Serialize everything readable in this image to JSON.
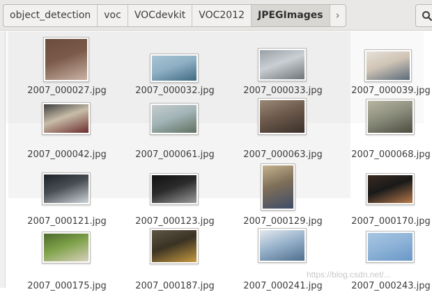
{
  "breadcrumb": [
    "object_detection",
    "voc",
    "VOCdevkit",
    "VOC2012",
    "JPEGImages"
  ],
  "breadcrumb_more_icon": "chevron-right-icon",
  "search_icon": "search-icon",
  "files": [
    {
      "name": "2007_000027.jpg",
      "colors": [
        "#7b5a4a",
        "#c9b3a5",
        "#6a4d3d"
      ]
    },
    {
      "name": "2007_000032.jpg",
      "colors": [
        "#8fb0c4",
        "#3f6a80",
        "#a6c4d3"
      ]
    },
    {
      "name": "2007_000033.jpg",
      "colors": [
        "#c9cfd3",
        "#6f7478",
        "#9aa1a6"
      ]
    },
    {
      "name": "2007_000039.jpg",
      "colors": [
        "#cfc4b5",
        "#5a6a7a",
        "#e6e0d8"
      ]
    },
    {
      "name": "2007_000042.jpg",
      "colors": [
        "#c8bda8",
        "#6b2c2c",
        "#3e3e3e"
      ]
    },
    {
      "name": "2007_000061.jpg",
      "colors": [
        "#a3b5b8",
        "#5f7060",
        "#c5cccc"
      ]
    },
    {
      "name": "2007_000063.jpg",
      "colors": [
        "#6d5a4c",
        "#3a302a",
        "#9a8877"
      ]
    },
    {
      "name": "2007_000068.jpg",
      "colors": [
        "#8d8f7e",
        "#4c4c40",
        "#b8b5a2"
      ]
    },
    {
      "name": "2007_000121.jpg",
      "colors": [
        "#4a4f55",
        "#cfd4d8",
        "#1e2226"
      ]
    },
    {
      "name": "2007_000123.jpg",
      "colors": [
        "#2b2b2b",
        "#9a9a9a",
        "#111111"
      ]
    },
    {
      "name": "2007_000129.jpg",
      "colors": [
        "#7e6f58",
        "#3e4c6a",
        "#c6b28e"
      ]
    },
    {
      "name": "2007_000170.jpg",
      "colors": [
        "#1a1a1a",
        "#b87a4c",
        "#3a2a22"
      ]
    },
    {
      "name": "2007_000175.jpg",
      "colors": [
        "#7fa24a",
        "#d8d0bc",
        "#4d6a2b"
      ]
    },
    {
      "name": "2007_000187.jpg",
      "colors": [
        "#3a3224",
        "#c79a3e",
        "#5e5544"
      ]
    },
    {
      "name": "2007_000241.jpg",
      "colors": [
        "#9ab4cc",
        "#4f6f8e",
        "#e3e8ec"
      ]
    },
    {
      "name": "2007_000243.jpg",
      "colors": [
        "#8fb4d8",
        "#6a98c6",
        "#a8c6e2"
      ]
    }
  ],
  "watermark": "https://blog.csdn.net/..."
}
